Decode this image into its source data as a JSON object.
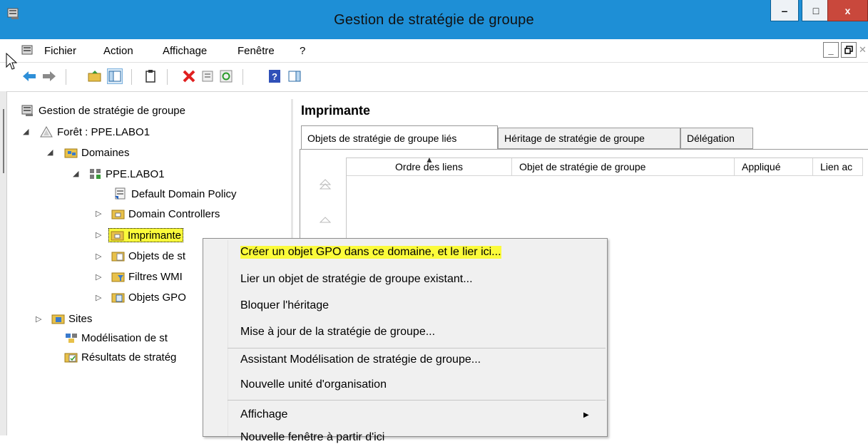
{
  "window": {
    "title": "Gestion de stratégie de groupe",
    "buttons": {
      "minimize": "‒",
      "maximize": "□",
      "close": "x"
    }
  },
  "menu": {
    "items": [
      "Fichier",
      "Action",
      "Affichage",
      "Fenêtre",
      "?"
    ]
  },
  "tree": {
    "root": "Gestion de stratégie de groupe",
    "forest": "Forêt : PPE.LABO1",
    "domains": "Domaines",
    "domain": "PPE.LABO1",
    "default_policy": "Default Domain Policy",
    "domain_controllers": "Domain Controllers",
    "imprimante": "Imprimante",
    "objets_strategie": "Objets de st",
    "filtres_wmi": "Filtres WMI",
    "objets_gpo": "Objets GPO",
    "sites": "Sites",
    "modelisation": "Modélisation de st",
    "resultats": "Résultats de stratég"
  },
  "right_pane": {
    "title": "Imprimante",
    "tabs": [
      "Objets de stratégie de groupe liés",
      "Héritage de stratégie de groupe",
      "Délégation"
    ],
    "columns": [
      "Ordre des liens",
      "Objet de stratégie de groupe",
      "Appliqué",
      "Lien ac"
    ]
  },
  "context_menu": {
    "items": [
      "Créer un objet GPO dans ce domaine, et le lier ici...",
      "Lier un objet de stratégie de groupe existant...",
      "Bloquer l'héritage",
      "Mise à jour de la stratégie de groupe...",
      "Assistant Modélisation de stratégie de groupe...",
      "Nouvelle unité d'organisation",
      "Affichage",
      "Nouvelle fenêtre à partir d'ici"
    ]
  },
  "colors": {
    "titlebar": "#1e8fd6",
    "highlight": "#fbfb3a",
    "close_button": "#c9483c"
  }
}
